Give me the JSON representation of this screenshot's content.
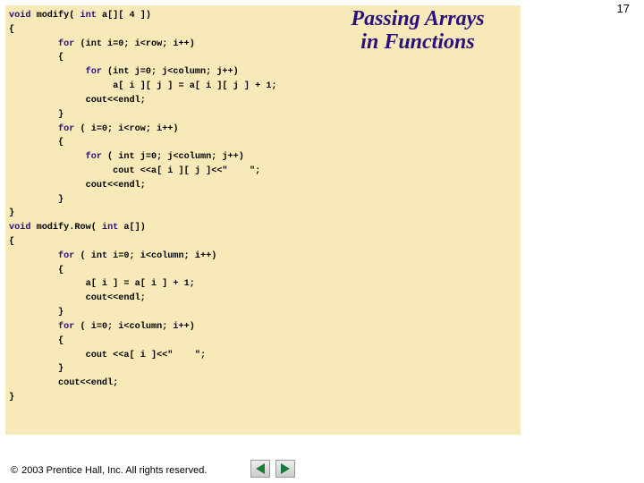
{
  "page_number": "17",
  "title_line1": "Passing Arrays",
  "title_line2": "in Functions",
  "code": {
    "l01a": "void",
    "l01b": " modify( ",
    "l01c": "int",
    "l01d": " a[][ 4 ])",
    "l02": "{",
    "l03a": "         for",
    "l03b": " (int i=0; i<row; i++)",
    "l04": "         {",
    "l05a": "              for",
    "l05b": " (int j=0; j<column; j++)",
    "l06": "                   a[ i ][ j ] = a[ i ][ j ] + 1;",
    "l07": "              cout<<endl;",
    "l08": "         }",
    "l09a": "         for",
    "l09b": " ( i=0; i<row; i++)",
    "l10": "         {",
    "l11a": "              for",
    "l11b": " ( int j=0; j<column; j++)",
    "l12": "                   cout <<a[ i ][ j ]<<\"    \";",
    "l13": "              cout<<endl;",
    "l14": "         }",
    "l15": "}",
    "l16a": "void",
    "l16b": " modify.Row( ",
    "l16c": "int",
    "l16d": " a[])",
    "l17": "{",
    "l18a": "         for",
    "l18b": " ( int i=0; i<column; i++)",
    "l19": "         {",
    "l20": "              a[ i ] = a[ i ] + 1;",
    "l21": "              cout<<endl;",
    "l22": "         }",
    "l23a": "         for",
    "l23b": " ( i=0; i<column; i++)",
    "l24": "         {",
    "l25": "              cout <<a[ i ]<<\"    \";",
    "l26": "         }",
    "l27": "         cout<<endl;",
    "l28": "}"
  },
  "footer": {
    "copyright_symbol": "©",
    "text": "2003 Prentice Hall, Inc. All rights reserved."
  }
}
